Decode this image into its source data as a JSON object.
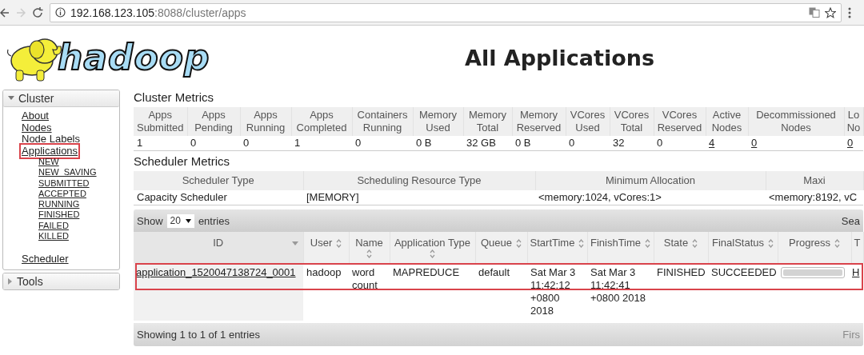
{
  "browser": {
    "address_host": "192.168.123.105",
    "address_path": ":8088/cluster/apps",
    "back_disabled": false,
    "forward_disabled": true
  },
  "header": {
    "logo_text": "hadoop",
    "title": "All Applications"
  },
  "sidebar": [
    {
      "label": "Cluster",
      "expanded": true,
      "items": [
        {
          "label": "About",
          "link": true,
          "highlighted": false
        },
        {
          "label": "Nodes",
          "link": true,
          "highlighted": false
        },
        {
          "label": "Node Labels",
          "link": false,
          "highlighted": false
        },
        {
          "label": "Applications",
          "link": true,
          "highlighted": true,
          "children": [
            {
              "label": "NEW"
            },
            {
              "label": "NEW_SAVING"
            },
            {
              "label": "SUBMITTED"
            },
            {
              "label": "ACCEPTED"
            },
            {
              "label": "RUNNING"
            },
            {
              "label": "FINISHED"
            },
            {
              "label": "FAILED"
            },
            {
              "label": "KILLED"
            }
          ]
        },
        {
          "label": "Scheduler",
          "link": true,
          "highlighted": false
        }
      ]
    },
    {
      "label": "Tools",
      "expanded": false
    }
  ],
  "cluster_metrics": {
    "title": "Cluster Metrics",
    "columns": [
      "Apps Submitted",
      "Apps Pending",
      "Apps Running",
      "Apps Completed",
      "Containers Running",
      "Memory Used",
      "Memory Total",
      "Memory Reserved",
      "VCores Used",
      "VCores Total",
      "VCores Reserved",
      "Active Nodes",
      "Decommissioned Nodes",
      "Lo No"
    ],
    "values": [
      {
        "text": "1",
        "link": false
      },
      {
        "text": "0",
        "link": false
      },
      {
        "text": "0",
        "link": false
      },
      {
        "text": "1",
        "link": false
      },
      {
        "text": "0",
        "link": false
      },
      {
        "text": "0 B",
        "link": false
      },
      {
        "text": "32 GB",
        "link": false
      },
      {
        "text": "0 B",
        "link": false
      },
      {
        "text": "0",
        "link": false
      },
      {
        "text": "32",
        "link": false
      },
      {
        "text": "0",
        "link": false
      },
      {
        "text": "4",
        "link": true
      },
      {
        "text": "0",
        "link": true
      },
      {
        "text": "0",
        "link": true
      }
    ]
  },
  "scheduler_metrics": {
    "title": "Scheduler Metrics",
    "columns": [
      "Scheduler Type",
      "Scheduling Resource Type",
      "Minimum Allocation",
      "Maxi"
    ],
    "values": [
      "Capacity Scheduler",
      "[MEMORY]",
      "<memory:1024, vCores:1>",
      "<memory:8192, vC"
    ]
  },
  "apps": {
    "show_label": "Show",
    "page_size": "20",
    "entries_label": "entries",
    "search_label": "Sea",
    "columns": [
      {
        "label": "ID",
        "sortable": true,
        "sorted": true
      },
      {
        "label": "User",
        "sortable": true,
        "sorted": false
      },
      {
        "label": "Name",
        "sortable": true,
        "sorted": false
      },
      {
        "label": "Application Type",
        "sortable": true,
        "sorted": false
      },
      {
        "label": "Queue",
        "sortable": true,
        "sorted": false
      },
      {
        "label": "StartTime",
        "sortable": true,
        "sorted": false
      },
      {
        "label": "FinishTime",
        "sortable": true,
        "sorted": false
      },
      {
        "label": "State",
        "sortable": true,
        "sorted": false
      },
      {
        "label": "FinalStatus",
        "sortable": true,
        "sorted": false
      },
      {
        "label": "Progress",
        "sortable": true,
        "sorted": false
      },
      {
        "label": "T",
        "sortable": false,
        "sorted": false
      }
    ],
    "rows": [
      {
        "highlighted": true,
        "id": "application_1520047138724_0001",
        "user": "hadoop",
        "name": "word count",
        "type": "MAPREDUCE",
        "queue": "default",
        "start": "Sat Mar 3 11:42:12 +0800 2018",
        "finish": "Sat Mar 3 11:42:41 +0800 2018",
        "state": "FINISHED",
        "final_status": "SUCCEEDED",
        "progress": {
          "level": 1
        },
        "tracking": "H"
      }
    ],
    "footer": "Showing 1 to 1 of 1 entries",
    "pager": "Firs"
  }
}
